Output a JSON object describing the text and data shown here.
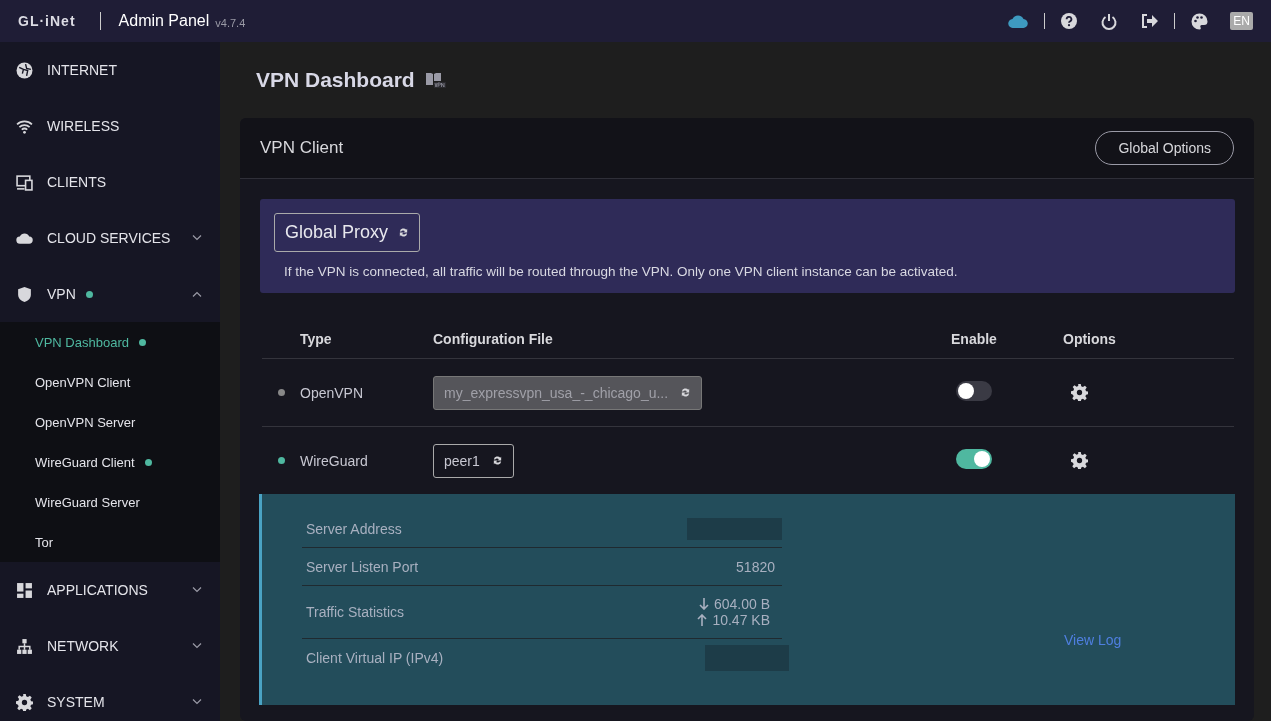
{
  "header": {
    "logo": "GL·iNet",
    "title": "Admin Panel",
    "version": "v4.7.4",
    "language": "EN"
  },
  "sidebar": {
    "items": [
      {
        "kind": "link",
        "label": "INTERNET",
        "dot": false
      },
      {
        "kind": "link",
        "label": "WIRELESS",
        "dot": false
      },
      {
        "kind": "link",
        "label": "CLIENTS",
        "dot": false
      },
      {
        "kind": "group",
        "label": "CLOUD SERVICES",
        "dot": false,
        "expanded": false
      },
      {
        "kind": "group",
        "label": "VPN",
        "dot": true,
        "expanded": true,
        "children": [
          {
            "label": "VPN Dashboard",
            "selected": true,
            "dot": true
          },
          {
            "label": "OpenVPN Client",
            "selected": false,
            "dot": false
          },
          {
            "label": "OpenVPN Server",
            "selected": false,
            "dot": false
          },
          {
            "label": "WireGuard Client",
            "selected": false,
            "dot": true
          },
          {
            "label": "WireGuard Server",
            "selected": false,
            "dot": false
          },
          {
            "label": "Tor",
            "selected": false,
            "dot": false
          }
        ]
      },
      {
        "kind": "group",
        "label": "APPLICATIONS",
        "dot": false,
        "expanded": false
      },
      {
        "kind": "group",
        "label": "NETWORK",
        "dot": false,
        "expanded": false
      },
      {
        "kind": "group",
        "label": "SYSTEM",
        "dot": false,
        "expanded": false
      }
    ]
  },
  "page_title": "VPN Dashboard",
  "card": {
    "title": "VPN Client",
    "button": "Global Options",
    "proxy": {
      "mode": "Global Proxy",
      "note": "If the VPN is connected, all traffic will be routed through the VPN. Only one VPN client instance can be activated."
    },
    "columns": [
      "Type",
      "Configuration File",
      "Enable",
      "Options"
    ],
    "rows": [
      {
        "type": "OpenVPN",
        "config": "my_expressvpn_usa_-_chicago_u...",
        "connected": false,
        "enabled": false
      },
      {
        "type": "WireGuard",
        "config": "peer1",
        "connected": true,
        "enabled": true
      }
    ],
    "details": {
      "rows": [
        {
          "kind": "redacted",
          "label": "Server Address"
        },
        {
          "kind": "text",
          "label": "Server Listen Port",
          "value": "51820"
        },
        {
          "kind": "traffic",
          "label": "Traffic Statistics",
          "down": "604.00 B",
          "up": "10.47 KB"
        },
        {
          "kind": "redacted",
          "label": "Client Virtual IP (IPv4)"
        }
      ],
      "link": "View Log"
    }
  }
}
